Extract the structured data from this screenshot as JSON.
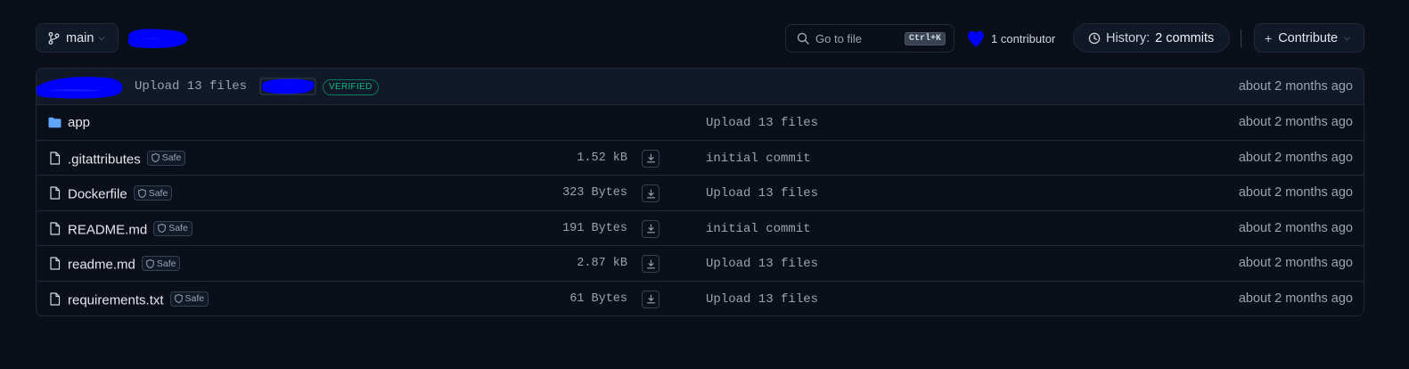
{
  "toolbar": {
    "branch": "main",
    "goto_placeholder": "Go to file",
    "goto_shortcut": "Ctrl+K",
    "contributors": "1 contributor",
    "history_label": "History:",
    "history_count": "2 commits",
    "contribute": "Contribute"
  },
  "last_commit": {
    "message": "Upload 13 files",
    "badge": "VERIFIED",
    "time": "about 2 months ago"
  },
  "files": [
    {
      "type": "folder",
      "name": "app",
      "safe": "",
      "size": "",
      "commit": "Upload 13 files",
      "time": "about 2 months ago"
    },
    {
      "type": "file",
      "name": ".gitattributes",
      "safe": "Safe",
      "size": "1.52 kB",
      "commit": "initial commit",
      "time": "about 2 months ago"
    },
    {
      "type": "file",
      "name": "Dockerfile",
      "safe": "Safe",
      "size": "323 Bytes",
      "commit": "Upload 13 files",
      "time": "about 2 months ago"
    },
    {
      "type": "file",
      "name": "README.md",
      "safe": "Safe",
      "size": "191 Bytes",
      "commit": "initial commit",
      "time": "about 2 months ago"
    },
    {
      "type": "file",
      "name": "readme.md",
      "safe": "Safe",
      "size": "2.87 kB",
      "commit": "Upload 13 files",
      "time": "about 2 months ago"
    },
    {
      "type": "file",
      "name": "requirements.txt",
      "safe": "Safe",
      "size": "61 Bytes",
      "commit": "Upload 13 files",
      "time": "about 2 months ago"
    }
  ],
  "colors": {
    "background": "#0b0f19",
    "redaction": "#0000ff",
    "folder": "#60a5fa",
    "verified": "#10b981"
  }
}
